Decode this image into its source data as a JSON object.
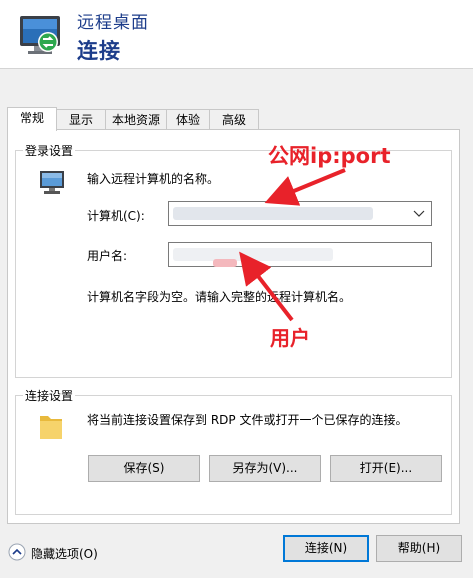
{
  "header": {
    "subtitle": "远程桌面",
    "title": "连接"
  },
  "tabs": [
    {
      "label": "常规",
      "active": true
    },
    {
      "label": "显示"
    },
    {
      "label": "本地资源"
    },
    {
      "label": "体验"
    },
    {
      "label": "高级"
    }
  ],
  "login_group": {
    "title": "登录设置",
    "prompt": "输入远程计算机的名称。",
    "computer_label": "计算机(C):",
    "computer_value": "",
    "username_label": "用户名:",
    "username_value": "",
    "warning": "计算机名字段为空。请输入完整的远程计算机名。"
  },
  "connection_group": {
    "title": "连接设置",
    "description": "将当前连接设置保存到 RDP 文件或打开一个已保存的连接。",
    "save_label": "保存(S)",
    "save_as_label": "另存为(V)...",
    "open_label": "打开(E)..."
  },
  "footer": {
    "hide_options_label": "隐藏选项(O)",
    "connect_label": "连接(N)",
    "help_label": "帮助(H)"
  },
  "annotations": {
    "public_ip_label": "公网ip:port",
    "user_label": "用户",
    "color": "#e8222a"
  },
  "colors": {
    "title_blue": "#1c3c8a",
    "accent": "#0078d7"
  }
}
